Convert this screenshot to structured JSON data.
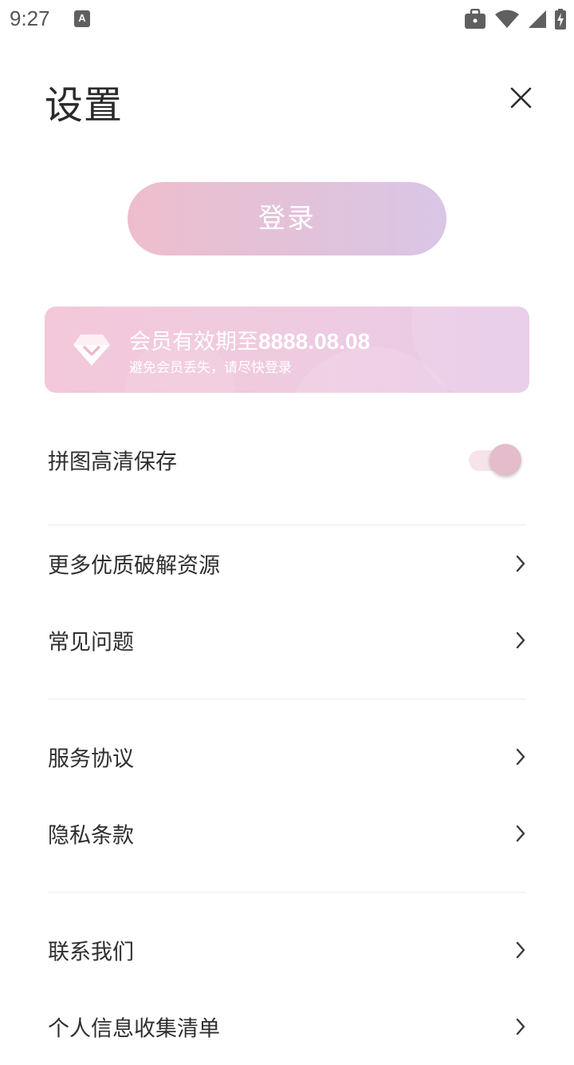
{
  "status_bar": {
    "time": "9:27",
    "notification_icon": "a-keyboard-icon",
    "right_icons": [
      "briefcase-icon",
      "wifi-icon",
      "signal-icon",
      "battery-charging-icon"
    ]
  },
  "header": {
    "title": "设置",
    "close_icon": "close-icon"
  },
  "login_button": {
    "label": "登录",
    "gradient": [
      "#eebdcd",
      "#d9c6e6"
    ]
  },
  "vip_card": {
    "icon": "diamond-icon",
    "title_prefix": "会员有效期至",
    "expiry_date": "8888.08.08",
    "subtitle": "避免会员丢失，请尽快登录"
  },
  "settings": {
    "hd_save": {
      "label": "拼图高清保存",
      "toggle_on": true
    },
    "items": [
      {
        "label": "更多优质破解资源"
      },
      {
        "label": "常见问题"
      },
      {
        "label": "服务协议"
      },
      {
        "label": "隐私条款"
      },
      {
        "label": "联系我们"
      },
      {
        "label": "个人信息收集清单"
      }
    ]
  },
  "colors": {
    "accent_pink": "#e4bccb",
    "text": "#2f2f2f",
    "divider": "#ececec"
  }
}
